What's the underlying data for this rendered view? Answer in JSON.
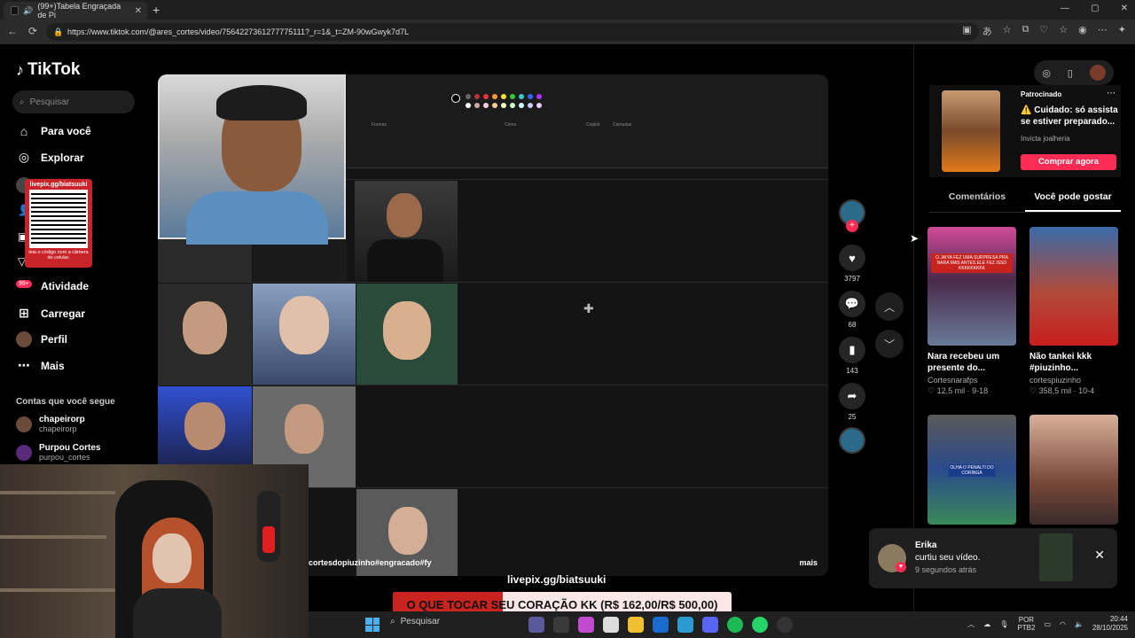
{
  "browser": {
    "tab_title": "(99+)Tabela Engraçada de Pi",
    "tab_close": "✕",
    "new_tab": "+",
    "url": "https://www.tiktok.com/@ares_cortes/video/7564227361277775111?_r=1&_t=ZM-90wGwyk7d7L",
    "window_controls": [
      "—",
      "▢",
      "✕"
    ]
  },
  "sidebar": {
    "logo": "TikTok",
    "search_placeholder": "Pesquisar",
    "items": [
      {
        "label": "Para você",
        "icon": "home-icon"
      },
      {
        "label": "Explorar",
        "icon": "compass-icon"
      },
      {
        "label": "Atividade",
        "icon": "inbox-icon"
      },
      {
        "label": "Carregar",
        "icon": "upload-icon"
      },
      {
        "label": "Perfil",
        "icon": "profile-icon"
      },
      {
        "label": "Mais",
        "icon": "more-icon"
      }
    ],
    "activity_badge": "99+",
    "qr": {
      "title": "livepix.gg/biatsuuki",
      "caption": "leia o código com a câmera do celular."
    },
    "following_title": "Contas que você segue",
    "following": [
      {
        "name": "chapeirorp",
        "handle": "chapeirorp"
      },
      {
        "name": "Purpou Cortes",
        "handle": "purpou_cortes"
      }
    ]
  },
  "video": {
    "caption": "cortesdopiuzinho#engracado#fy",
    "more": "mais",
    "paint_labels": [
      "Formas",
      "Cores",
      "Copilot",
      "Camadas"
    ]
  },
  "actions": {
    "likes": "3797",
    "comments": "68",
    "saves": "143",
    "shares": "25"
  },
  "right_panel": {
    "ad": {
      "label": "Patrocinado",
      "text": "⚠️ Cuidado: só assista se estiver preparado...",
      "brand": "Invicta joalheria",
      "button": "Comprar agora"
    },
    "tabs": [
      "Comentários",
      "Você pode gostar"
    ],
    "active_tab": 1,
    "recommendations": [
      {
        "title": "Nara recebeu um presente do...",
        "author": "Cortesnarafps",
        "stats": "♡ 12,5 mil · 9-18",
        "thumb_caption": "O JAIYA FEZ UMA SURPRESA PRA NARA MAS ANTES ELE FEZ ISSO KKKKKKKKK"
      },
      {
        "title": "Não tankei kkk #piuzinho...",
        "author": "cortespiuzinho",
        "stats": "♡ 358,5 mil · 10-4",
        "thumb_caption": ""
      },
      {
        "title": "",
        "author": "",
        "stats": "",
        "thumb_caption": "OLHA O PENALTI DO CORINGA"
      },
      {
        "title": "",
        "author": "",
        "stats": "",
        "thumb_caption": ""
      }
    ]
  },
  "notification": {
    "name": "Erika",
    "message": "curtiu seu vídeo.",
    "time": "9 segundos atrás",
    "close": "✕"
  },
  "stream_overlay": {
    "livepix": "livepix.gg/biatsuuki",
    "donation_text": "O QUE TOCAR SEU CORAÇÃO KK (R$ 162,00/R$ 500,00)",
    "donation_progress": 0.324
  },
  "taskbar": {
    "search": "Pesquisar",
    "lang": [
      "POR",
      "PTB2"
    ],
    "time": "20:44",
    "date": "28/10/2025"
  },
  "colors": {
    "accent": "#fe2c55",
    "donation_fill": "#c8231f"
  }
}
